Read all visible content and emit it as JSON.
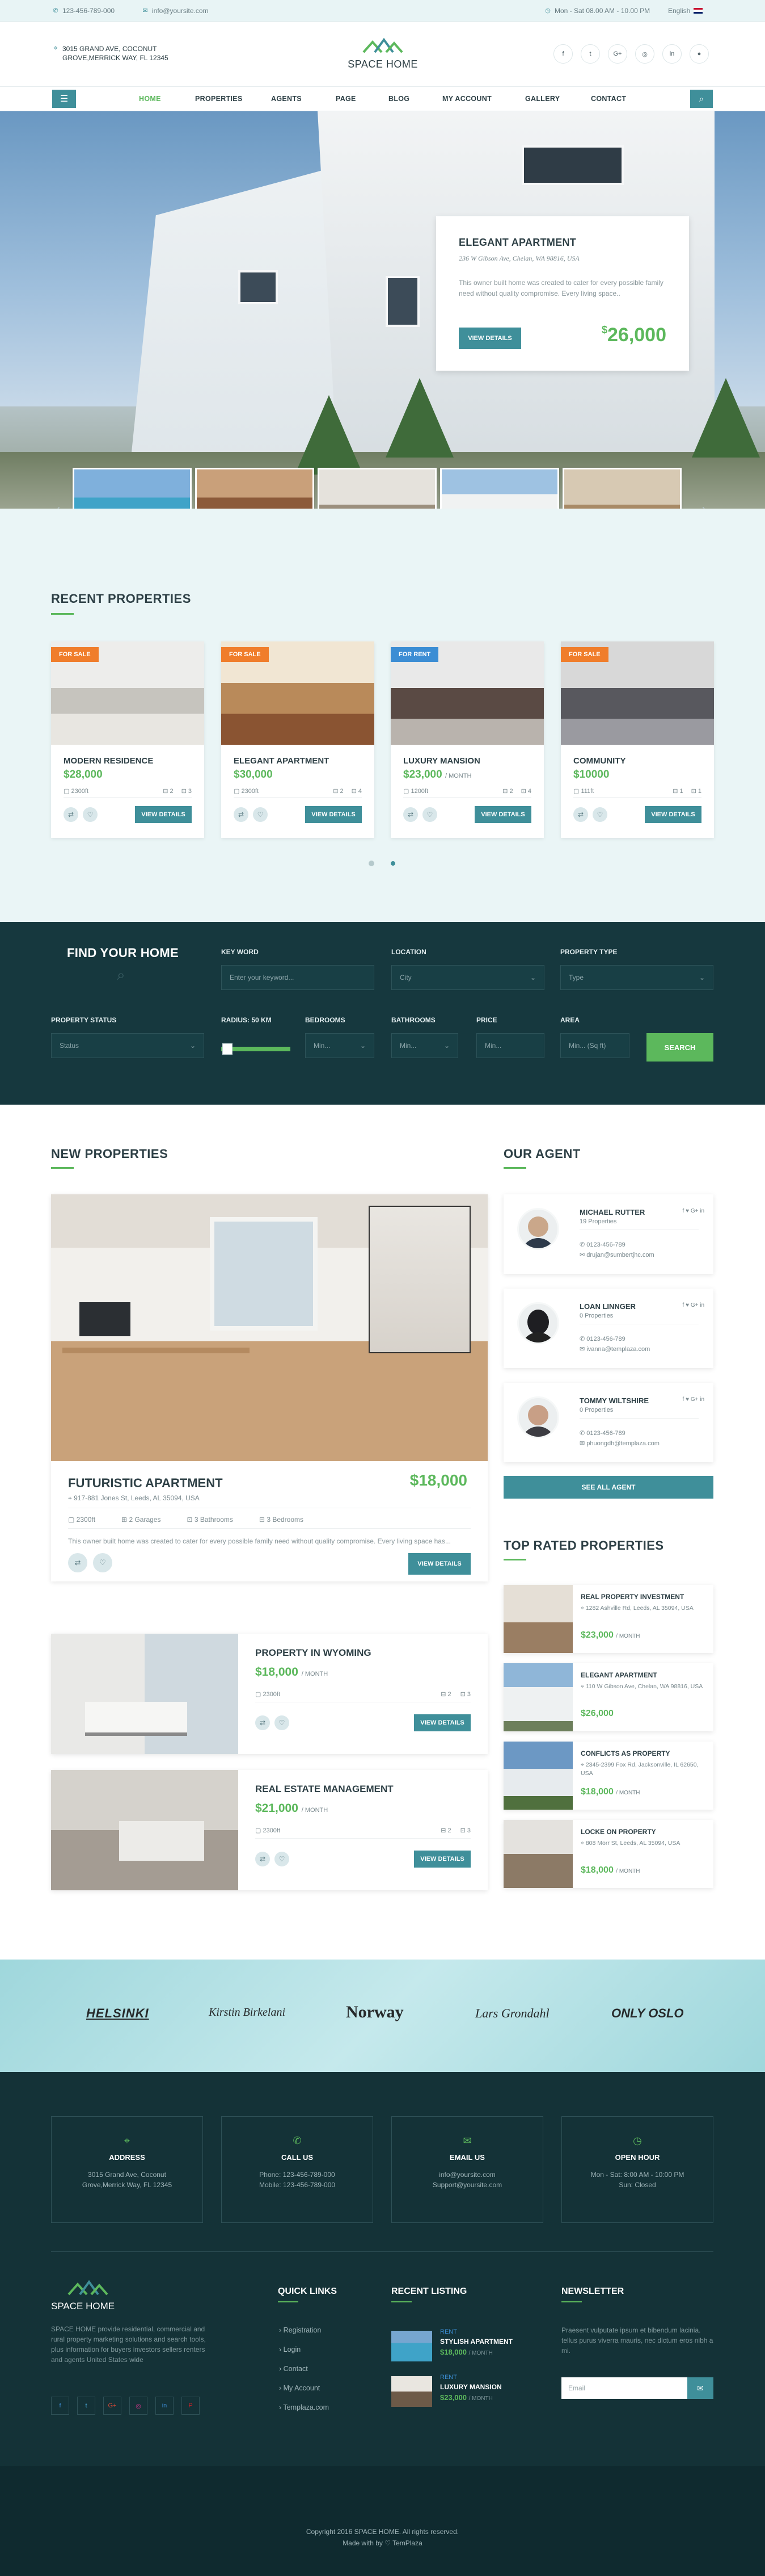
{
  "topbar": {
    "phone": "123-456-789-000",
    "email": "info@yoursite.com",
    "hours": "Mon - Sat 08.00 AM - 10.00 PM",
    "language": "English"
  },
  "header": {
    "brand": "SPACE HOME",
    "address_line1": "3015 GRAND AVE, COCONUT",
    "address_line2": "GROVE,MERRICK WAY, FL 12345",
    "social": [
      "f",
      "t",
      "G+",
      "◎",
      "in",
      "●"
    ]
  },
  "nav": {
    "items": [
      "HOME",
      "PROPERTIES",
      "AGENTS",
      "PAGE",
      "BLOG",
      "MY ACCOUNT",
      "GALLERY",
      "CONTACT"
    ],
    "active": "HOME"
  },
  "hero": {
    "title": "ELEGANT APARTMENT",
    "address": "236 W Gibson Ave, Chelan, WA 98816, USA",
    "description": "This owner built home was created to cater for every possible family need without quality compromise. Every living space..",
    "button": "VIEW DETAILS",
    "currency": "$",
    "price": "26,000"
  },
  "recent": {
    "title": "RECENT PROPERTIES",
    "cards": [
      {
        "tag": "FOR SALE",
        "name": "MODERN RESIDENCE",
        "price": "$28,000",
        "period": "",
        "area": "2300ft",
        "beds": "2",
        "baths": "3",
        "button": "VIEW DETAILS"
      },
      {
        "tag": "FOR SALE",
        "name": "ELEGANT APARTMENT",
        "price": "$30,000",
        "period": "",
        "area": "2300ft",
        "beds": "2",
        "baths": "4",
        "button": "VIEW DETAILS"
      },
      {
        "tag": "FOR RENT",
        "name": "LUXURY MANSION",
        "price": "$23,000",
        "period": "/ MONTH",
        "area": "1200ft",
        "beds": "2",
        "baths": "4",
        "button": "VIEW DETAILS"
      },
      {
        "tag": "FOR SALE",
        "name": "COMMUNITY",
        "price": "$10000",
        "period": "",
        "area": "111ft",
        "beds": "1",
        "baths": "1",
        "button": "VIEW DETAILS"
      }
    ]
  },
  "find": {
    "title": "FIND YOUR HOME",
    "keyword_label": "KEY WORD",
    "keyword_placeholder": "Enter your keyword...",
    "location_label": "LOCATION",
    "location_value": "City",
    "type_label": "PROPERTY TYPE",
    "type_value": "Type",
    "status_label": "PROPERTY STATUS",
    "status_value": "Status",
    "radius_label": "RADIUS: 50 KM",
    "bedrooms_label": "BEDROOMS",
    "bedrooms_value": "Min...",
    "bathrooms_label": "BATHROOMS",
    "bathrooms_value": "Min...",
    "price_label": "PRICE",
    "price_value": "Min...",
    "area_label": "AREA",
    "area_value": "Min... (Sq ft)",
    "button": "SEARCH"
  },
  "new_properties": {
    "title": "NEW PROPERTIES",
    "featured": {
      "name": "FUTURISTIC APARTMENT",
      "price": "$18,000",
      "address": "917-881 Jones St, Leeds, AL 35094, USA",
      "area": "2300ft",
      "garages": "2 Garages",
      "bathrooms": "3 Bathrooms",
      "bedrooms": "3 Bedrooms",
      "description": "This owner built home was created to cater for every possible family need without quality compromise. Every living space has...",
      "button": "VIEW DETAILS"
    },
    "list": [
      {
        "name": "PROPERTY IN WYOMING",
        "price": "$18,000",
        "period": "/ MONTH",
        "area": "2300ft",
        "beds": "2",
        "baths": "3",
        "button": "VIEW DETAILS"
      },
      {
        "name": "REAL ESTATE MANAGEMENT",
        "price": "$21,000",
        "period": "/ MONTH",
        "area": "2300ft",
        "beds": "2",
        "baths": "3",
        "button": "VIEW DETAILS"
      }
    ]
  },
  "agents": {
    "title": "OUR AGENT",
    "items": [
      {
        "name": "MICHAEL RUTTER",
        "props": "19 Properties",
        "phone": "0123-456-789",
        "email": "drujan@sumbertjhc.com"
      },
      {
        "name": "LOAN LINNGER",
        "props": "0 Properties",
        "phone": "0123-456-789",
        "email": "ivanna@templaza.com"
      },
      {
        "name": "TOMMY WILTSHIRE",
        "props": "0 Properties",
        "phone": "0123-456-789",
        "email": "phuongdh@templaza.com"
      }
    ],
    "see_all": "SEE ALL AGENT"
  },
  "top_rated": {
    "title": "TOP RATED PROPERTIES",
    "items": [
      {
        "name": "REAL PROPERTY INVESTMENT",
        "address": "1282 Ashville Rd, Leeds, AL 35094, USA",
        "price": "$23,000",
        "period": "/ MONTH"
      },
      {
        "name": "ELEGANT APARTMENT",
        "address": "110 W Gibson Ave, Chelan, WA 98816, USA",
        "price": "$26,000",
        "period": ""
      },
      {
        "name": "CONFLICTS AS PROPERTY",
        "address": "2345-2399 Fox Rd, Jacksonville, IL 62650, USA",
        "price": "$18,000",
        "period": "/ MONTH"
      },
      {
        "name": "LOCKE ON PROPERTY",
        "address": "808 Morr St, Leeds, AL 35094, USA",
        "price": "$18,000",
        "period": "/ MONTH"
      }
    ]
  },
  "partners": [
    "HELSINKI",
    "Kirstin Birkelani",
    "Norway",
    "Lars Grondahl",
    "ONLY OSLO"
  ],
  "footer": {
    "boxes": [
      {
        "title": "ADDRESS",
        "l1": "3015 Grand Ave, Coconut",
        "l2": "Grove,Merrick Way, FL 12345"
      },
      {
        "title": "CALL US",
        "l1": "Phone: 123-456-789-000",
        "l2": "Mobile: 123-456-789-000"
      },
      {
        "title": "EMAIL US",
        "l1": "info@yoursite.com",
        "l2": "Support@yoursite.com"
      },
      {
        "title": "OPEN HOUR",
        "l1": "Mon - Sat: 8:00 AM - 10:00 PM",
        "l2": "Sun: Closed"
      }
    ],
    "about": "SPACE HOME provide residential, commercial and rural property marketing solutions and search tools, plus information for buyers investors sellers renters and agents United States wide",
    "quick_links_title": "QUICK LINKS",
    "quick_links": [
      "Registration",
      "Login",
      "Contact",
      "My Account",
      "Templaza.com"
    ],
    "recent_title": "RECENT LISTING",
    "recent": [
      {
        "tag": "RENT",
        "name": "STYLISH APARTMENT",
        "price": "$18,000",
        "period": "/ MONTH"
      },
      {
        "tag": "RENT",
        "name": "LUXURY MANSION",
        "price": "$23,000",
        "period": "/ MONTH"
      }
    ],
    "newsletter_title": "NEWSLETTER",
    "newsletter_text": "Praesent vulputate ipsum et bibendum lacinia. tellus purus viverra mauris, nec dictum eros nibh a mi.",
    "newsletter_placeholder": "Email",
    "copyright": "Copyright 2016 SPACE HOME. All rights reserved.",
    "made_with": "Made with by ♡ TemPlaza"
  },
  "colors": {
    "accent": "#3f8f9a",
    "green": "#5cb85c",
    "dark": "#16383e",
    "orange": "#f07d2b",
    "blue": "#3c8dd4"
  }
}
